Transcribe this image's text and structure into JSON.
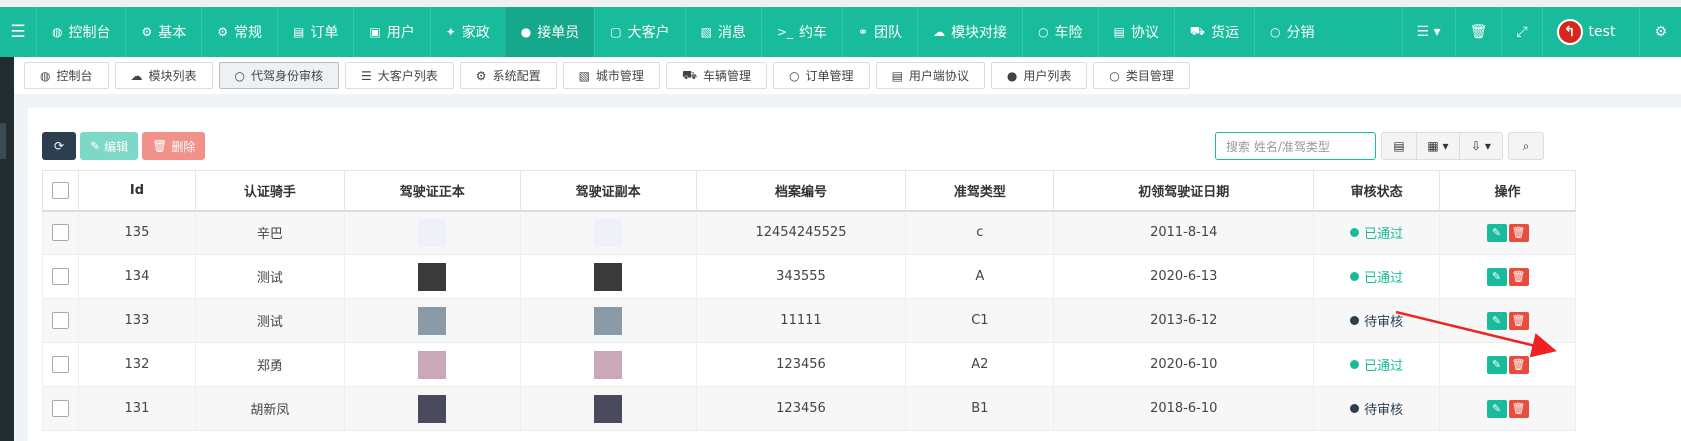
{
  "navbar": {
    "items": [
      {
        "label": "控制台",
        "icon": "dashboard-icon",
        "glyph": "◍"
      },
      {
        "label": "基本",
        "icon": "gear-icon",
        "glyph": "⚙"
      },
      {
        "label": "常规",
        "icon": "gears-icon",
        "glyph": "⚙"
      },
      {
        "label": "订单",
        "icon": "book-icon",
        "glyph": "▤"
      },
      {
        "label": "用户",
        "icon": "user-card-icon",
        "glyph": "▣"
      },
      {
        "label": "家政",
        "icon": "walking-icon",
        "glyph": "✦"
      },
      {
        "label": "接单员",
        "icon": "user-icon",
        "glyph": "●",
        "active": true
      },
      {
        "label": "大客户",
        "icon": "id-card-icon",
        "glyph": "▢"
      },
      {
        "label": "消息",
        "icon": "message-icon",
        "glyph": "▧"
      },
      {
        "label": "约车",
        "icon": "terminal-icon",
        "glyph": ">_"
      },
      {
        "label": "团队",
        "icon": "handshake-icon",
        "glyph": "⚭"
      },
      {
        "label": "模块对接",
        "icon": "cloud-icon",
        "glyph": "☁"
      },
      {
        "label": "车险",
        "icon": "circle-icon",
        "glyph": "○"
      },
      {
        "label": "协议",
        "icon": "list-alt-icon",
        "glyph": "▤"
      },
      {
        "label": "货运",
        "icon": "truck-icon",
        "glyph": "⛟"
      },
      {
        "label": "分销",
        "icon": "circle-icon",
        "glyph": "○"
      }
    ],
    "right": {
      "menu_glyph": "☰ ▾",
      "trash_glyph": "🗑",
      "expand_glyph": "⤢",
      "avatar_glyph": "↰",
      "username": "test",
      "settings_glyph": "⚙"
    }
  },
  "tabs": [
    {
      "label": "控制台",
      "glyph": "◍"
    },
    {
      "label": "模块列表",
      "glyph": "☁"
    },
    {
      "label": "代驾身份审核",
      "glyph": "○",
      "active": true
    },
    {
      "label": "大客户列表",
      "glyph": "☰"
    },
    {
      "label": "系统配置",
      "glyph": "⚙"
    },
    {
      "label": "城市管理",
      "glyph": "▧"
    },
    {
      "label": "车辆管理",
      "glyph": "⛟"
    },
    {
      "label": "订单管理",
      "glyph": "○"
    },
    {
      "label": "用户端协议",
      "glyph": "▤"
    },
    {
      "label": "用户列表",
      "glyph": "●"
    },
    {
      "label": "类目管理",
      "glyph": "○"
    }
  ],
  "toolbar": {
    "refresh_glyph": "⟳",
    "edit_label": "编辑",
    "edit_glyph": "✎",
    "delete_label": "删除",
    "delete_glyph": "🗑",
    "search_placeholder": "搜索 姓名/准驾类型",
    "view_glyph": "▤",
    "columns_glyph": "▦ ▾",
    "export_glyph": "⇩ ▾",
    "search_glyph": "⌕"
  },
  "table": {
    "columns": [
      "Id",
      "认证骑手",
      "驾驶证正本",
      "驾驶证副本",
      "档案编号",
      "准驾类型",
      "初领驾驶证日期",
      "审核状态",
      "操作"
    ],
    "rows": [
      {
        "id": "135",
        "rider": "辛巴",
        "license_no": "12454245525",
        "class": "c",
        "date": "2011-8-14",
        "status": "已通过",
        "status_type": "ok",
        "thumb": "#eef1f8"
      },
      {
        "id": "134",
        "rider": "测试",
        "license_no": "343555",
        "class": "A",
        "date": "2020-6-13",
        "status": "已通过",
        "status_type": "ok",
        "thumb": "#3b3b3b"
      },
      {
        "id": "133",
        "rider": "测试",
        "license_no": "11111",
        "class": "C1",
        "date": "2013-6-12",
        "status": "待审核",
        "status_type": "pend",
        "thumb": "#8a9aa6"
      },
      {
        "id": "132",
        "rider": "郑勇",
        "license_no": "123456",
        "class": "A2",
        "date": "2020-6-10",
        "status": "已通过",
        "status_type": "ok",
        "thumb": "#c9a8b8"
      },
      {
        "id": "131",
        "rider": "胡新凤",
        "license_no": "123456",
        "class": "B1",
        "date": "2018-6-10",
        "status": "待审核",
        "status_type": "pend",
        "thumb": "#4a4a5e"
      }
    ],
    "edit_glyph": "✎",
    "delete_glyph": "🗑"
  },
  "colors": {
    "accent": "#18bc9c",
    "dark": "#2c3e50",
    "danger": "#e74c3c",
    "annotation": "#ee2222"
  }
}
